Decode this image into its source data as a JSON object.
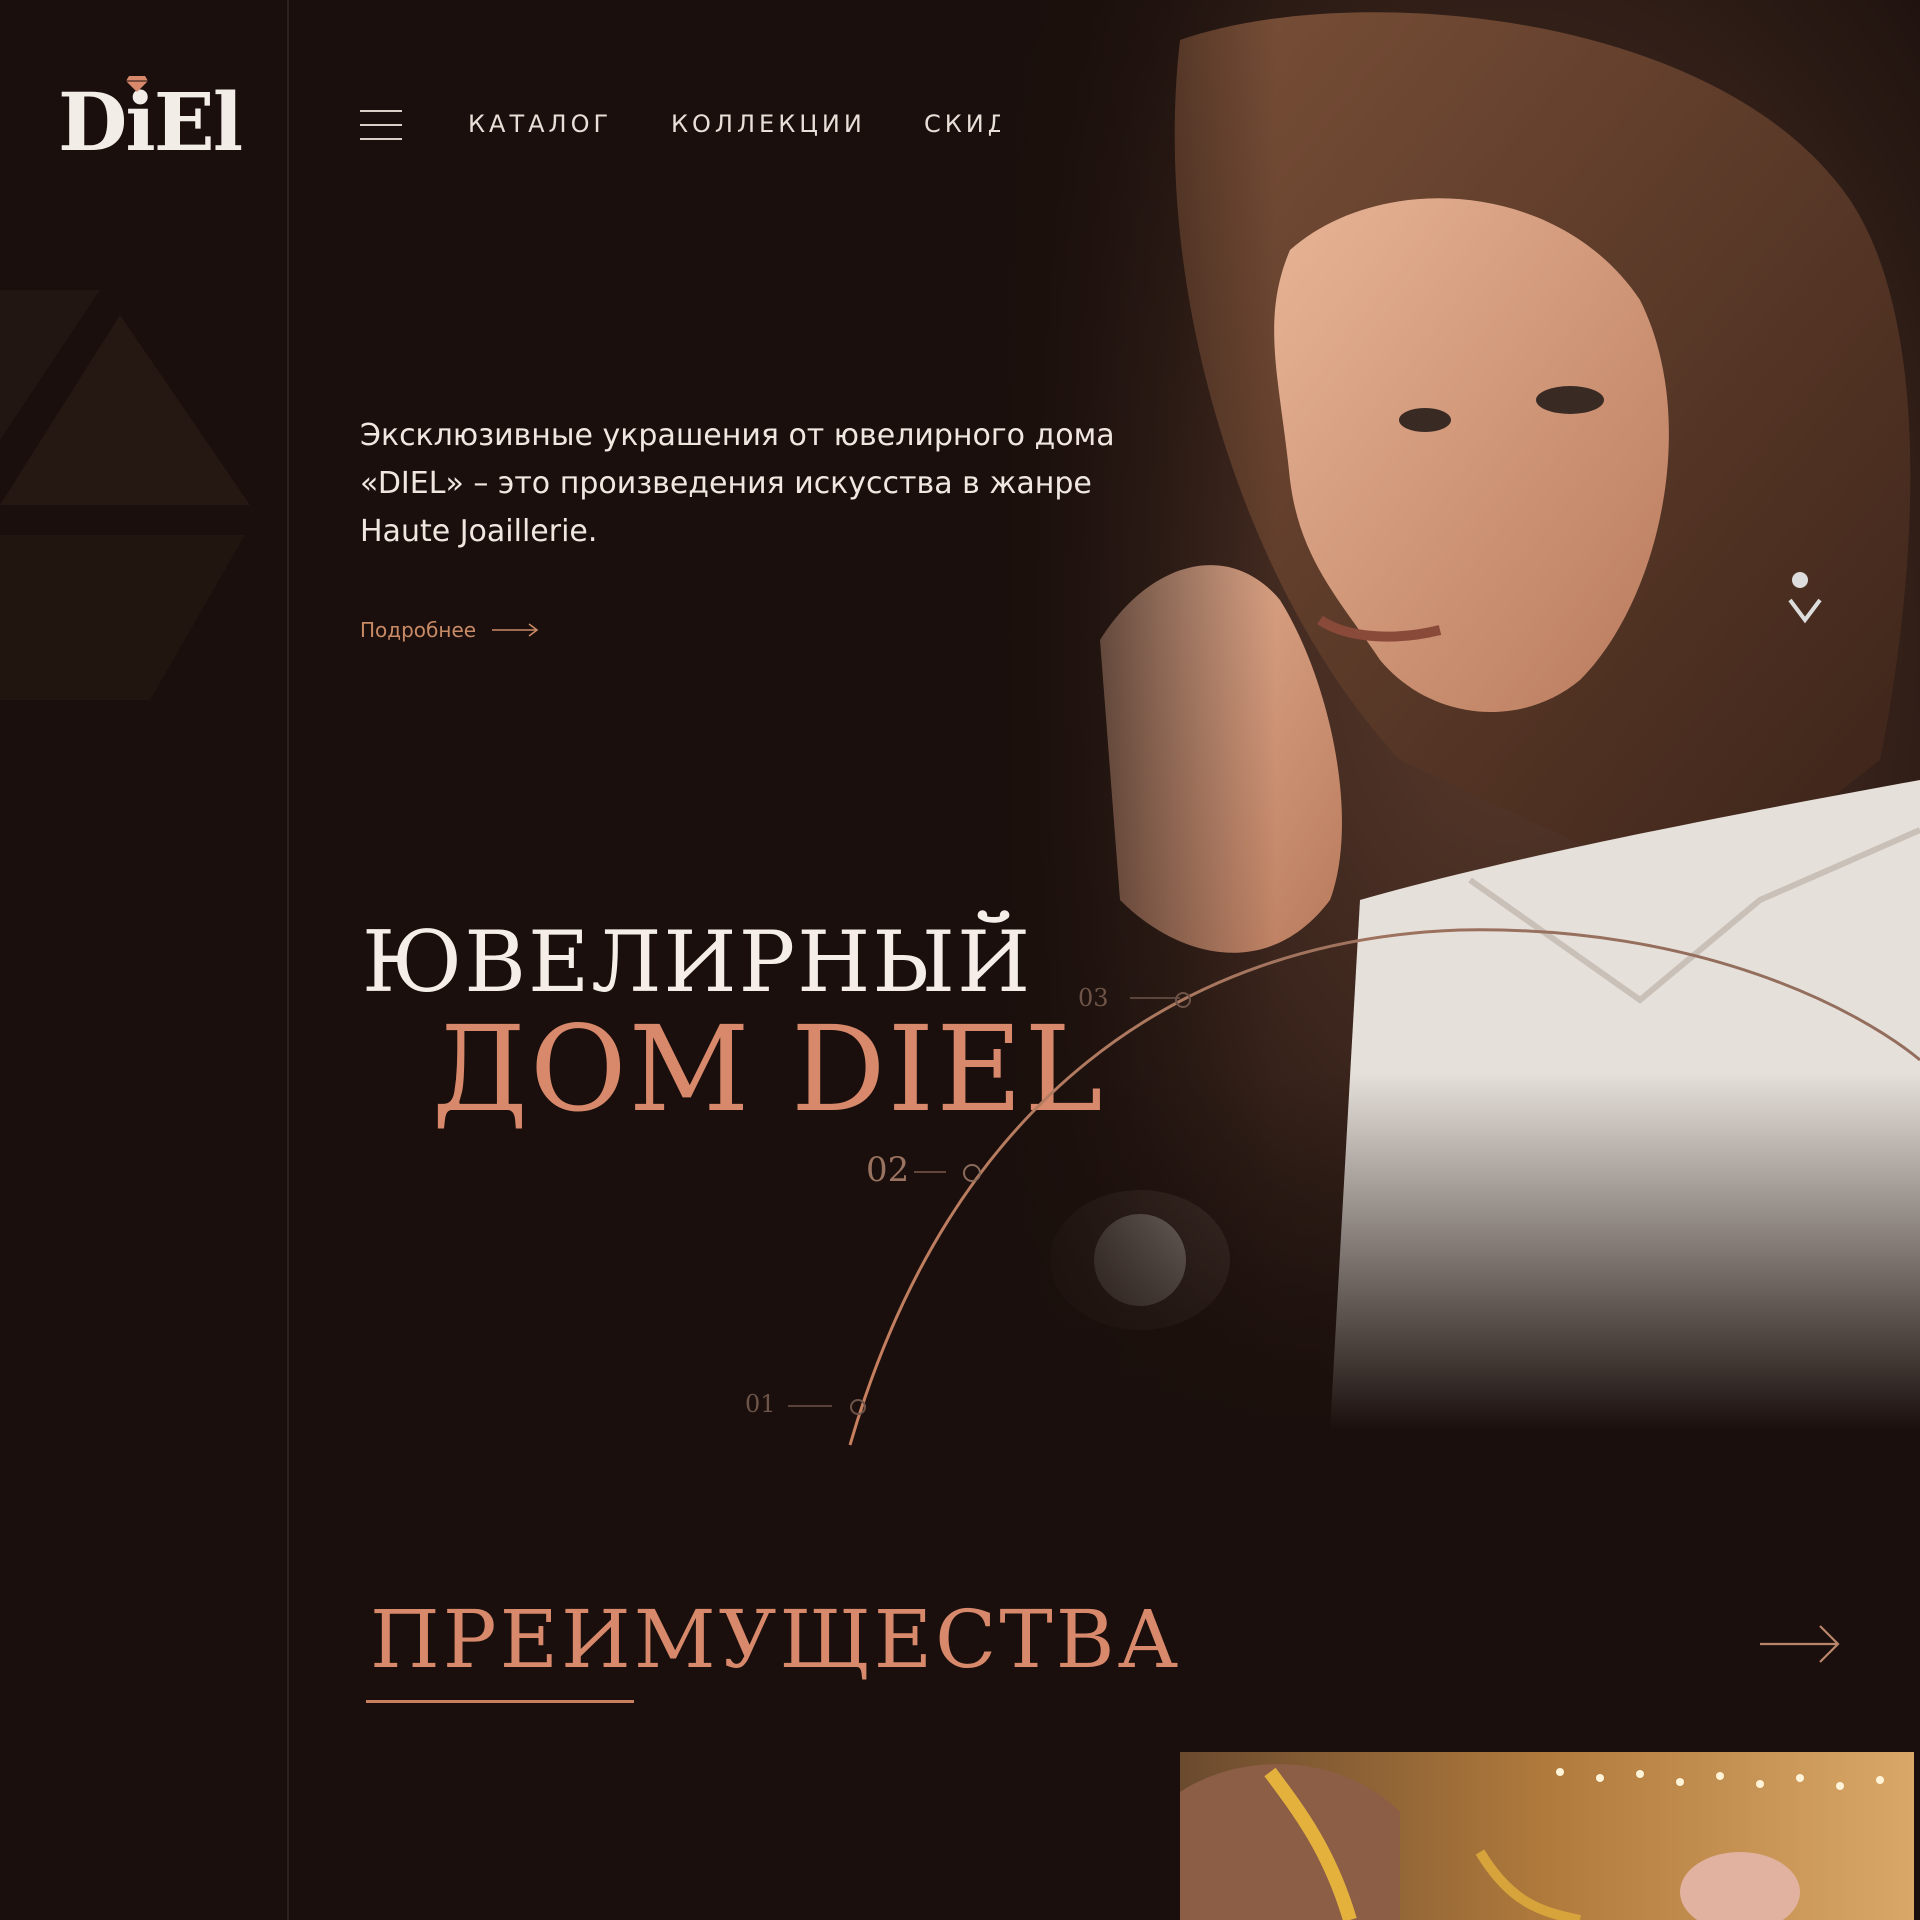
{
  "brand": {
    "logo_text": "DiEl"
  },
  "nav": {
    "items": [
      {
        "label": "КАТАЛОГ"
      },
      {
        "label": "КОЛЛЕКЦИИ"
      },
      {
        "label": "СКИДКИ И АКЦИИ"
      }
    ]
  },
  "icons": {
    "menu": "hamburger-icon",
    "search": "search-icon",
    "phone": "phone-icon",
    "favorites": "heart-icon"
  },
  "hero": {
    "intro_lines": [
      "Эксклюзивные украшения от ювелирного дома",
      "«DIEL» – это произведения искусства в жанре",
      "Haute Joaillerie."
    ],
    "more_label": "Подробнее",
    "headline_line1": "ЮВЕЛИРНЫЙ",
    "headline_line2": "ДОМ DIEL",
    "steps": [
      "01",
      "02",
      "03"
    ],
    "active_step": "02"
  },
  "advantages": {
    "title": "ПРЕИМУЩЕСТВА"
  },
  "colors": {
    "background": "#1a0f0c",
    "accent": "#d8896b",
    "text": "#ece4dc"
  }
}
